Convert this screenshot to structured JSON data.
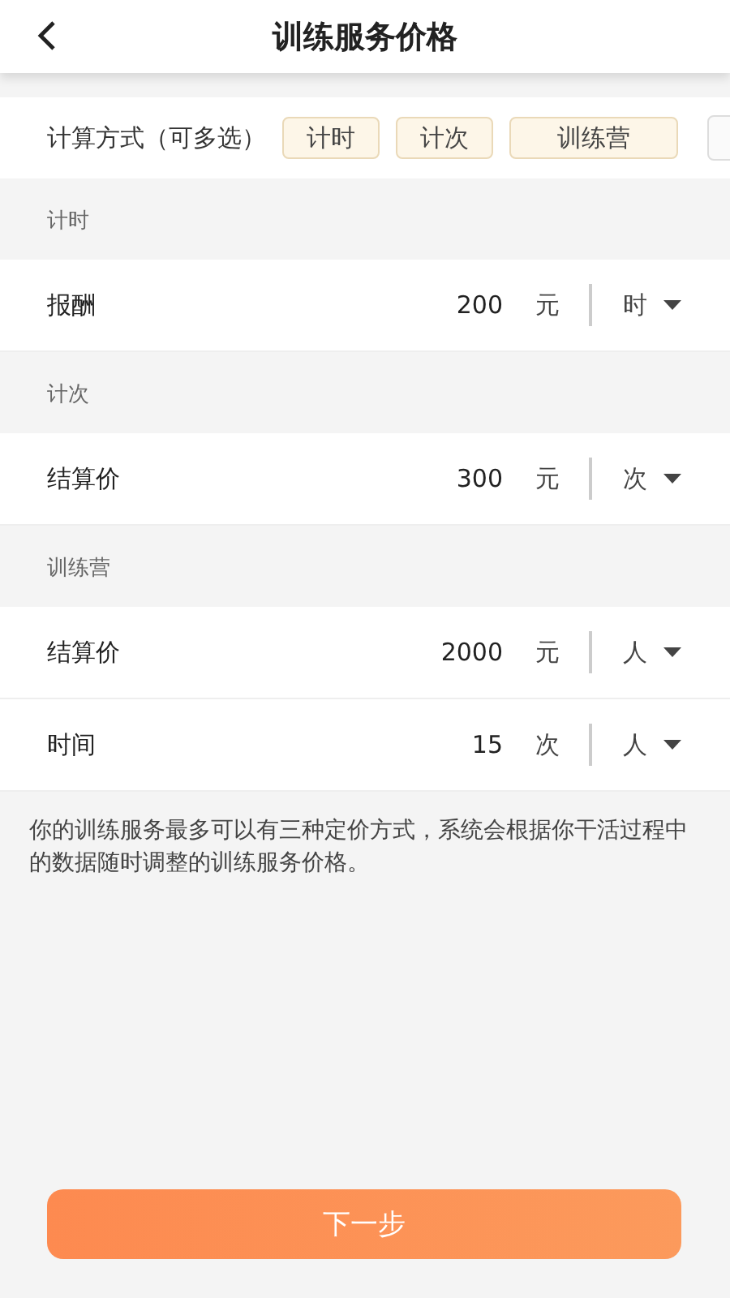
{
  "header": {
    "title": "训练服务价格"
  },
  "methods": {
    "label": "计算方式（可多选）",
    "options": [
      {
        "label": "计时",
        "selected": true
      },
      {
        "label": "计次",
        "selected": true
      },
      {
        "label": "训练营",
        "selected": true
      }
    ]
  },
  "sections": [
    {
      "title": "计时",
      "rows": [
        {
          "label": "报酬",
          "value": "200",
          "unit": "元",
          "per": "时"
        }
      ]
    },
    {
      "title": "计次",
      "rows": [
        {
          "label": "结算价",
          "value": "300",
          "unit": "元",
          "per": "次"
        }
      ]
    },
    {
      "title": "训练营",
      "rows": [
        {
          "label": "结算价",
          "value": "2000",
          "unit": "元",
          "per": "人"
        },
        {
          "label": "时间",
          "value": "15",
          "unit": "次",
          "per": "人"
        }
      ]
    }
  ],
  "note": "你的训练服务最多可以有三种定价方式，系统会根据你干活过程中的数据随时调整的训练服务价格。",
  "next_button": "下一步"
}
